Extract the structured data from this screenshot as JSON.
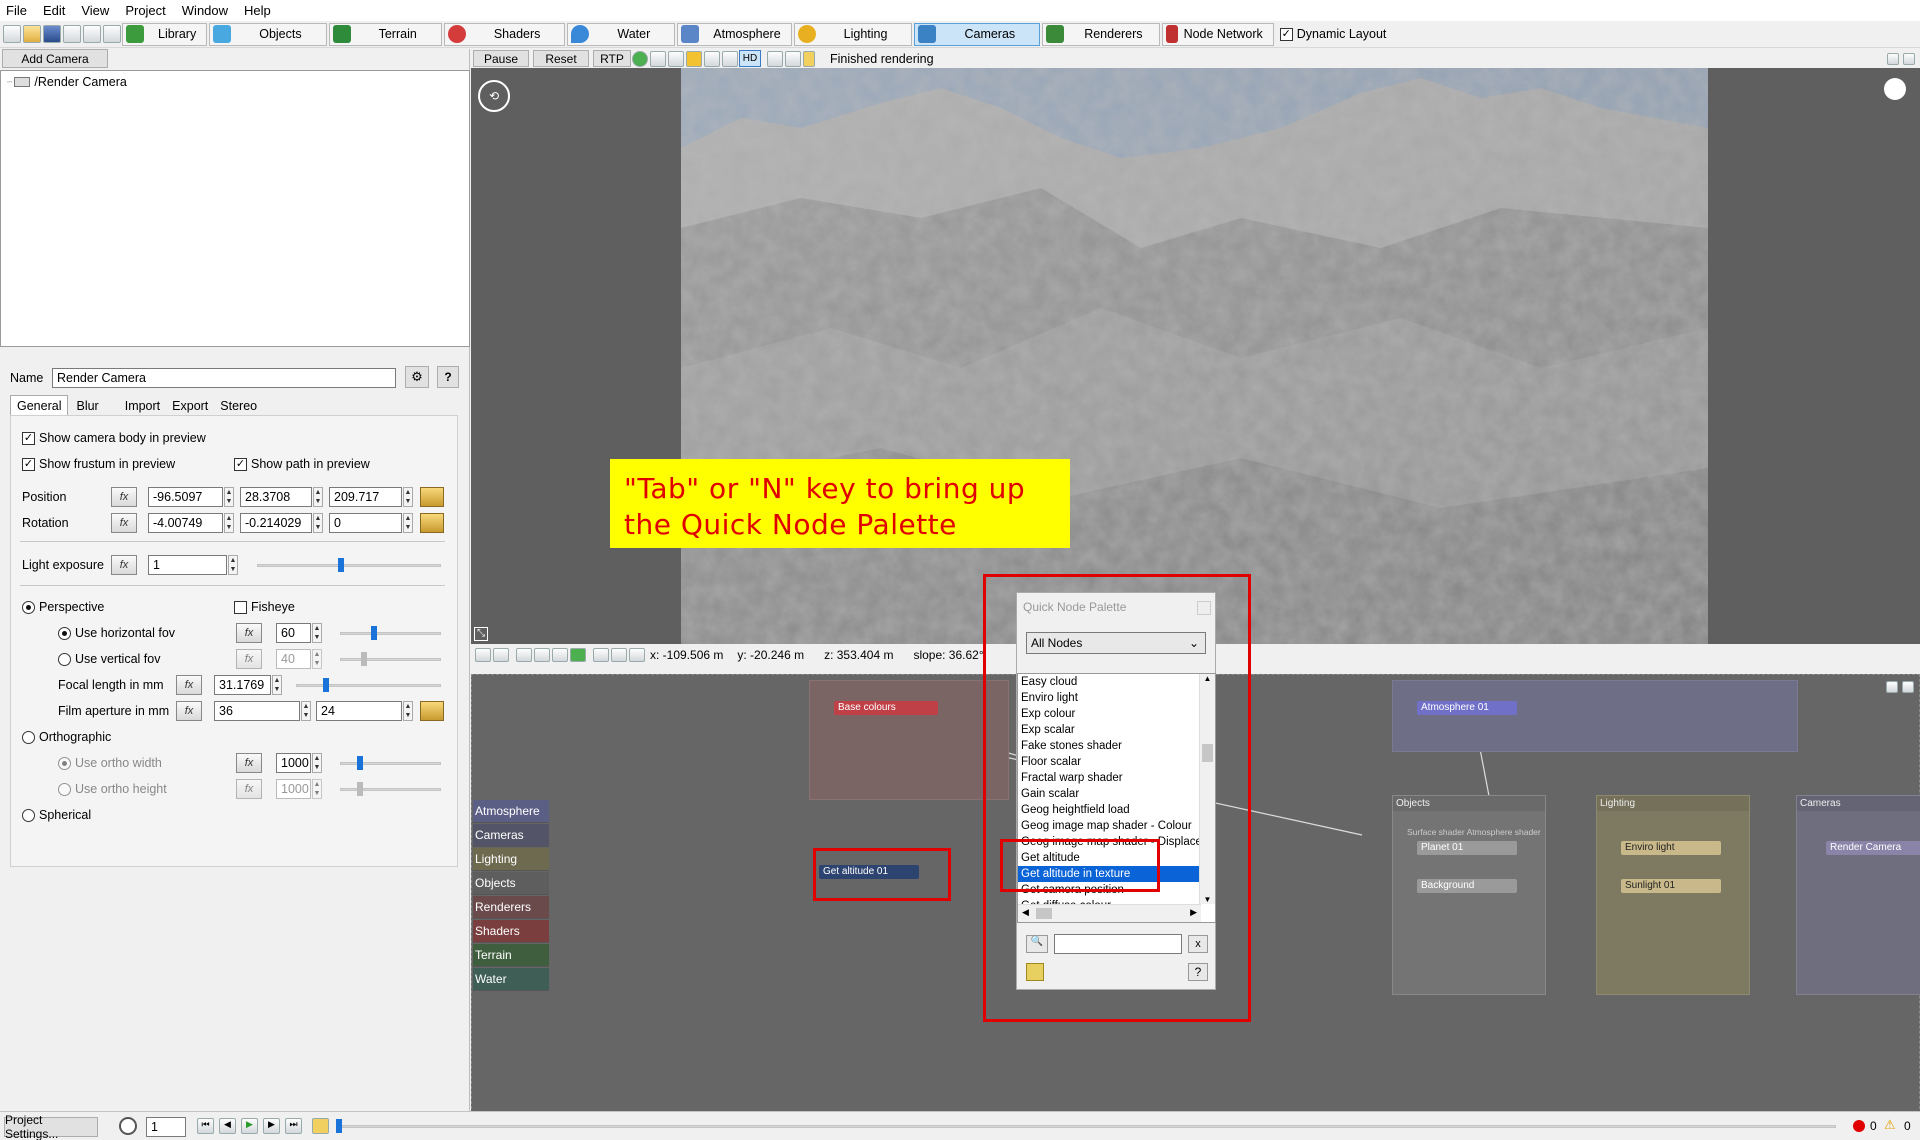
{
  "menu": [
    "File",
    "Edit",
    "View",
    "Project",
    "Window",
    "Help"
  ],
  "toolbar": {
    "tabs": [
      {
        "label": "Library",
        "color": "#3c9b3c"
      },
      {
        "label": "Objects",
        "color": "#4aa8e0"
      },
      {
        "label": "Terrain",
        "color": "#2e8b3a"
      },
      {
        "label": "Shaders",
        "color": "#d43c3c"
      },
      {
        "label": "Water",
        "color": "#3a88d8"
      },
      {
        "label": "Atmosphere",
        "color": "#5a86c8"
      },
      {
        "label": "Lighting",
        "color": "#e8b020"
      },
      {
        "label": "Cameras",
        "color": "#3b82c4"
      },
      {
        "label": "Renderers",
        "color": "#3a8a3a"
      },
      {
        "label": "Node Network",
        "color": "#c03030"
      }
    ],
    "dynamic_layout": "Dynamic Layout"
  },
  "left": {
    "add_camera": "Add Camera",
    "tree_item": "/Render Camera",
    "name_label": "Name",
    "name_value": "Render Camera",
    "help": "?",
    "tabs": [
      "General",
      "Blur",
      "Import",
      "Export",
      "Stereo"
    ],
    "show_body": "Show camera body in preview",
    "show_frustum": "Show frustum in preview",
    "show_path": "Show path in preview",
    "position_label": "Position",
    "position": [
      "-96.5097",
      "28.3708",
      "209.717"
    ],
    "rotation_label": "Rotation",
    "rotation": [
      "-4.00749",
      "-0.214029",
      "0"
    ],
    "light_exposure_label": "Light exposure",
    "light_exposure": "1",
    "perspective": "Perspective",
    "fisheye": "Fisheye",
    "use_hfov": "Use horizontal fov",
    "hfov": "60",
    "use_vfov": "Use vertical fov",
    "vfov": "40",
    "focal_label": "Focal length in mm",
    "focal": "31.1769",
    "aperture_label": "Film aperture in mm",
    "aperture": [
      "36",
      "24"
    ],
    "orthographic": "Orthographic",
    "ortho_width_label": "Use ortho width",
    "ortho_width": "1000",
    "ortho_height_label": "Use ortho height",
    "ortho_height": "1000",
    "spherical": "Spherical",
    "fx": "fx"
  },
  "viewport": {
    "pause": "Pause",
    "reset": "Reset",
    "rtp": "RTP",
    "hd": "HD",
    "status": "Finished rendering",
    "coords": {
      "x": "x: -109.506 m",
      "y": "y: -20.246 m",
      "z": "z: 353.404 m",
      "slope": "slope: 36.62°"
    }
  },
  "annotation": {
    "line1": "\"Tab\" or \"N\" key to bring up",
    "line2": "the Quick Node Palette"
  },
  "nodes": {
    "base_colours": "Base colours",
    "atmosphere01": "Atmosphere 01",
    "get_altitude01": "Get altitude 01",
    "objects_group": "Objects",
    "surface_shader": "Surface shader",
    "atmosphere_shader": "Atmosphere shader",
    "planet01": "Planet 01",
    "background": "Background",
    "lighting_group": "Lighting",
    "enviro_light": "Enviro light",
    "sunlight01": "Sunlight 01",
    "cameras_group": "Cameras",
    "render_camera": "Render Camera"
  },
  "categories": [
    {
      "label": "Atmosphere",
      "color": "#5b5f86"
    },
    {
      "label": "Cameras",
      "color": "#545468"
    },
    {
      "label": "Lighting",
      "color": "#6e6a50"
    },
    {
      "label": "Objects",
      "color": "#5e5e5e"
    },
    {
      "label": "Renderers",
      "color": "#6a4a4a"
    },
    {
      "label": "Shaders",
      "color": "#7a3e3e"
    },
    {
      "label": "Terrain",
      "color": "#3e5e3e"
    },
    {
      "label": "Water",
      "color": "#3e5e56"
    }
  ],
  "palette": {
    "title": "Quick Node Palette",
    "filter": "All Nodes",
    "items": [
      "Easy cloud",
      "Enviro light",
      "Exp colour",
      "Exp scalar",
      "Fake stones shader",
      "Floor scalar",
      "Fractal warp shader",
      "Gain scalar",
      "Geog heightfield load",
      "Geog image map shader - Colour",
      "Geog image map shader - Displacement",
      "Get altitude",
      "Get altitude in texture",
      "Get camera position",
      "Get diffuse colour"
    ],
    "selected_index": 12,
    "close": "x",
    "help": "?"
  },
  "statusbar": {
    "project_settings": "Project Settings...",
    "frame": "1",
    "errors": "0",
    "warnings": "0"
  }
}
